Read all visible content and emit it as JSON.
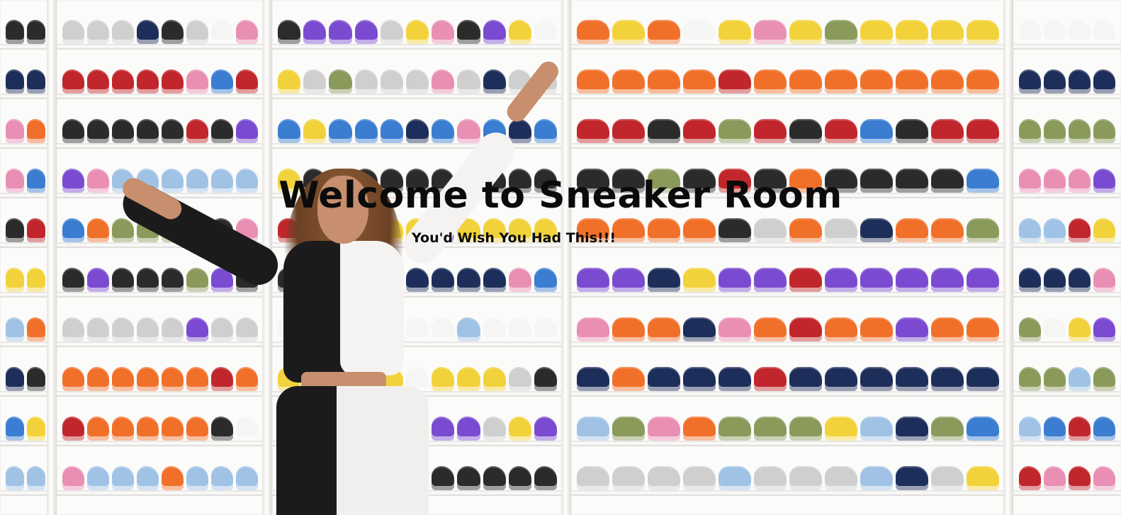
{
  "hero": {
    "title": "Welcome to Sneaker Room",
    "subtitle": "You'd Wish You Had This!!!"
  },
  "colors": {
    "text": "#0b0b0b",
    "shelf": "#fbfbfa",
    "outfit_black": "#1c1b1c",
    "outfit_white": "#f4f3f1",
    "shoe_palette": [
      "#f0702a",
      "#c0262b",
      "#1e2e5a",
      "#3a7dd1",
      "#f5f5f4",
      "#2b2b2b",
      "#f2d23a",
      "#e98fb3",
      "#8a9a5b",
      "#cfcfcf",
      "#7a4bd0",
      "#9fc2e5"
    ]
  }
}
